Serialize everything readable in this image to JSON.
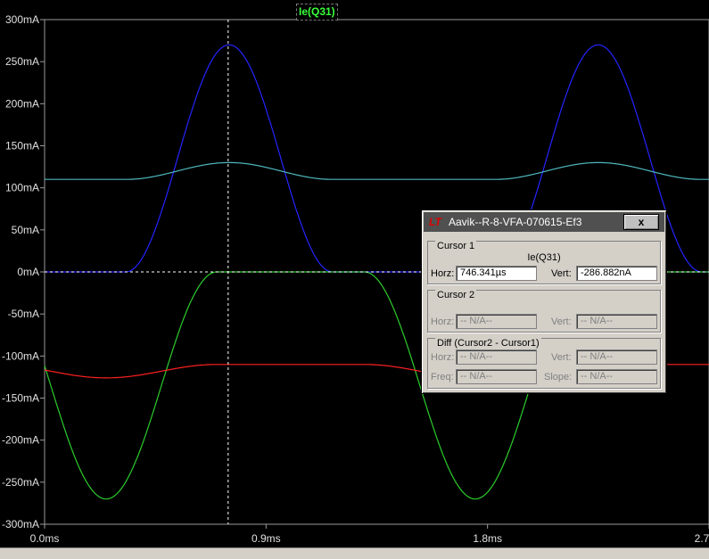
{
  "chart_data": {
    "type": "line",
    "trace_label": "Ie(Q31)",
    "xlim": [
      0.0,
      2.7
    ],
    "xunit": "ms",
    "xticks": [
      "0.0ms",
      "0.9ms",
      "1.8ms",
      "2.7ms"
    ],
    "ylim": [
      -300,
      300
    ],
    "yunit": "mA",
    "yticks": [
      "300mA",
      "250mA",
      "200mA",
      "150mA",
      "100mA",
      "50mA",
      "0mA",
      "-50mA",
      "-100mA",
      "-150mA",
      "-200mA",
      "-250mA",
      "-300mA"
    ],
    "cursor_x_ms": 0.746,
    "series": [
      {
        "color": "#2424ff",
        "kind": "pos_lobe",
        "period_ms": 1.5,
        "peak_ms": 0.75,
        "half_width_ms": 0.42,
        "amplitude": 270
      },
      {
        "color": "#2ccc2c",
        "kind": "neg_lobe",
        "period_ms": 1.5,
        "peak_ms": 0.25,
        "half_width_ms": 0.45,
        "amplitude": -270
      },
      {
        "color": "#4fb8bf",
        "kind": "plateau",
        "period_ms": 1.5,
        "peak_ms": 0.75,
        "half_width_ms": 0.42,
        "base": 110,
        "amplitude": 20
      },
      {
        "color": "#ff2020",
        "kind": "plateau",
        "period_ms": 1.5,
        "peak_ms": 0.25,
        "half_width_ms": 0.45,
        "base": -110,
        "amplitude": -16
      }
    ]
  },
  "dialog": {
    "title": "Aavik--R-8-VFA-070615-Ef3",
    "close_label": "x",
    "cursor1": {
      "label": "Cursor 1",
      "trace": "Ie(Q31)",
      "horz_label": "Horz:",
      "horz_value": "746.341µs",
      "vert_label": "Vert:",
      "vert_value": "-286.882nA"
    },
    "cursor2": {
      "label": "Cursor 2",
      "horz_label": "Horz:",
      "horz_value": "-- N/A--",
      "vert_label": "Vert:",
      "vert_value": "-- N/A--"
    },
    "diff": {
      "label": "Diff (Cursor2 - Cursor1)",
      "horz_label": "Horz:",
      "horz_value": "-- N/A--",
      "vert_label": "Vert:",
      "vert_value": "-- N/A--",
      "freq_label": "Freq:",
      "freq_value": "-- N/A--",
      "slope_label": "Slope:",
      "slope_value": "-- N/A--"
    }
  }
}
